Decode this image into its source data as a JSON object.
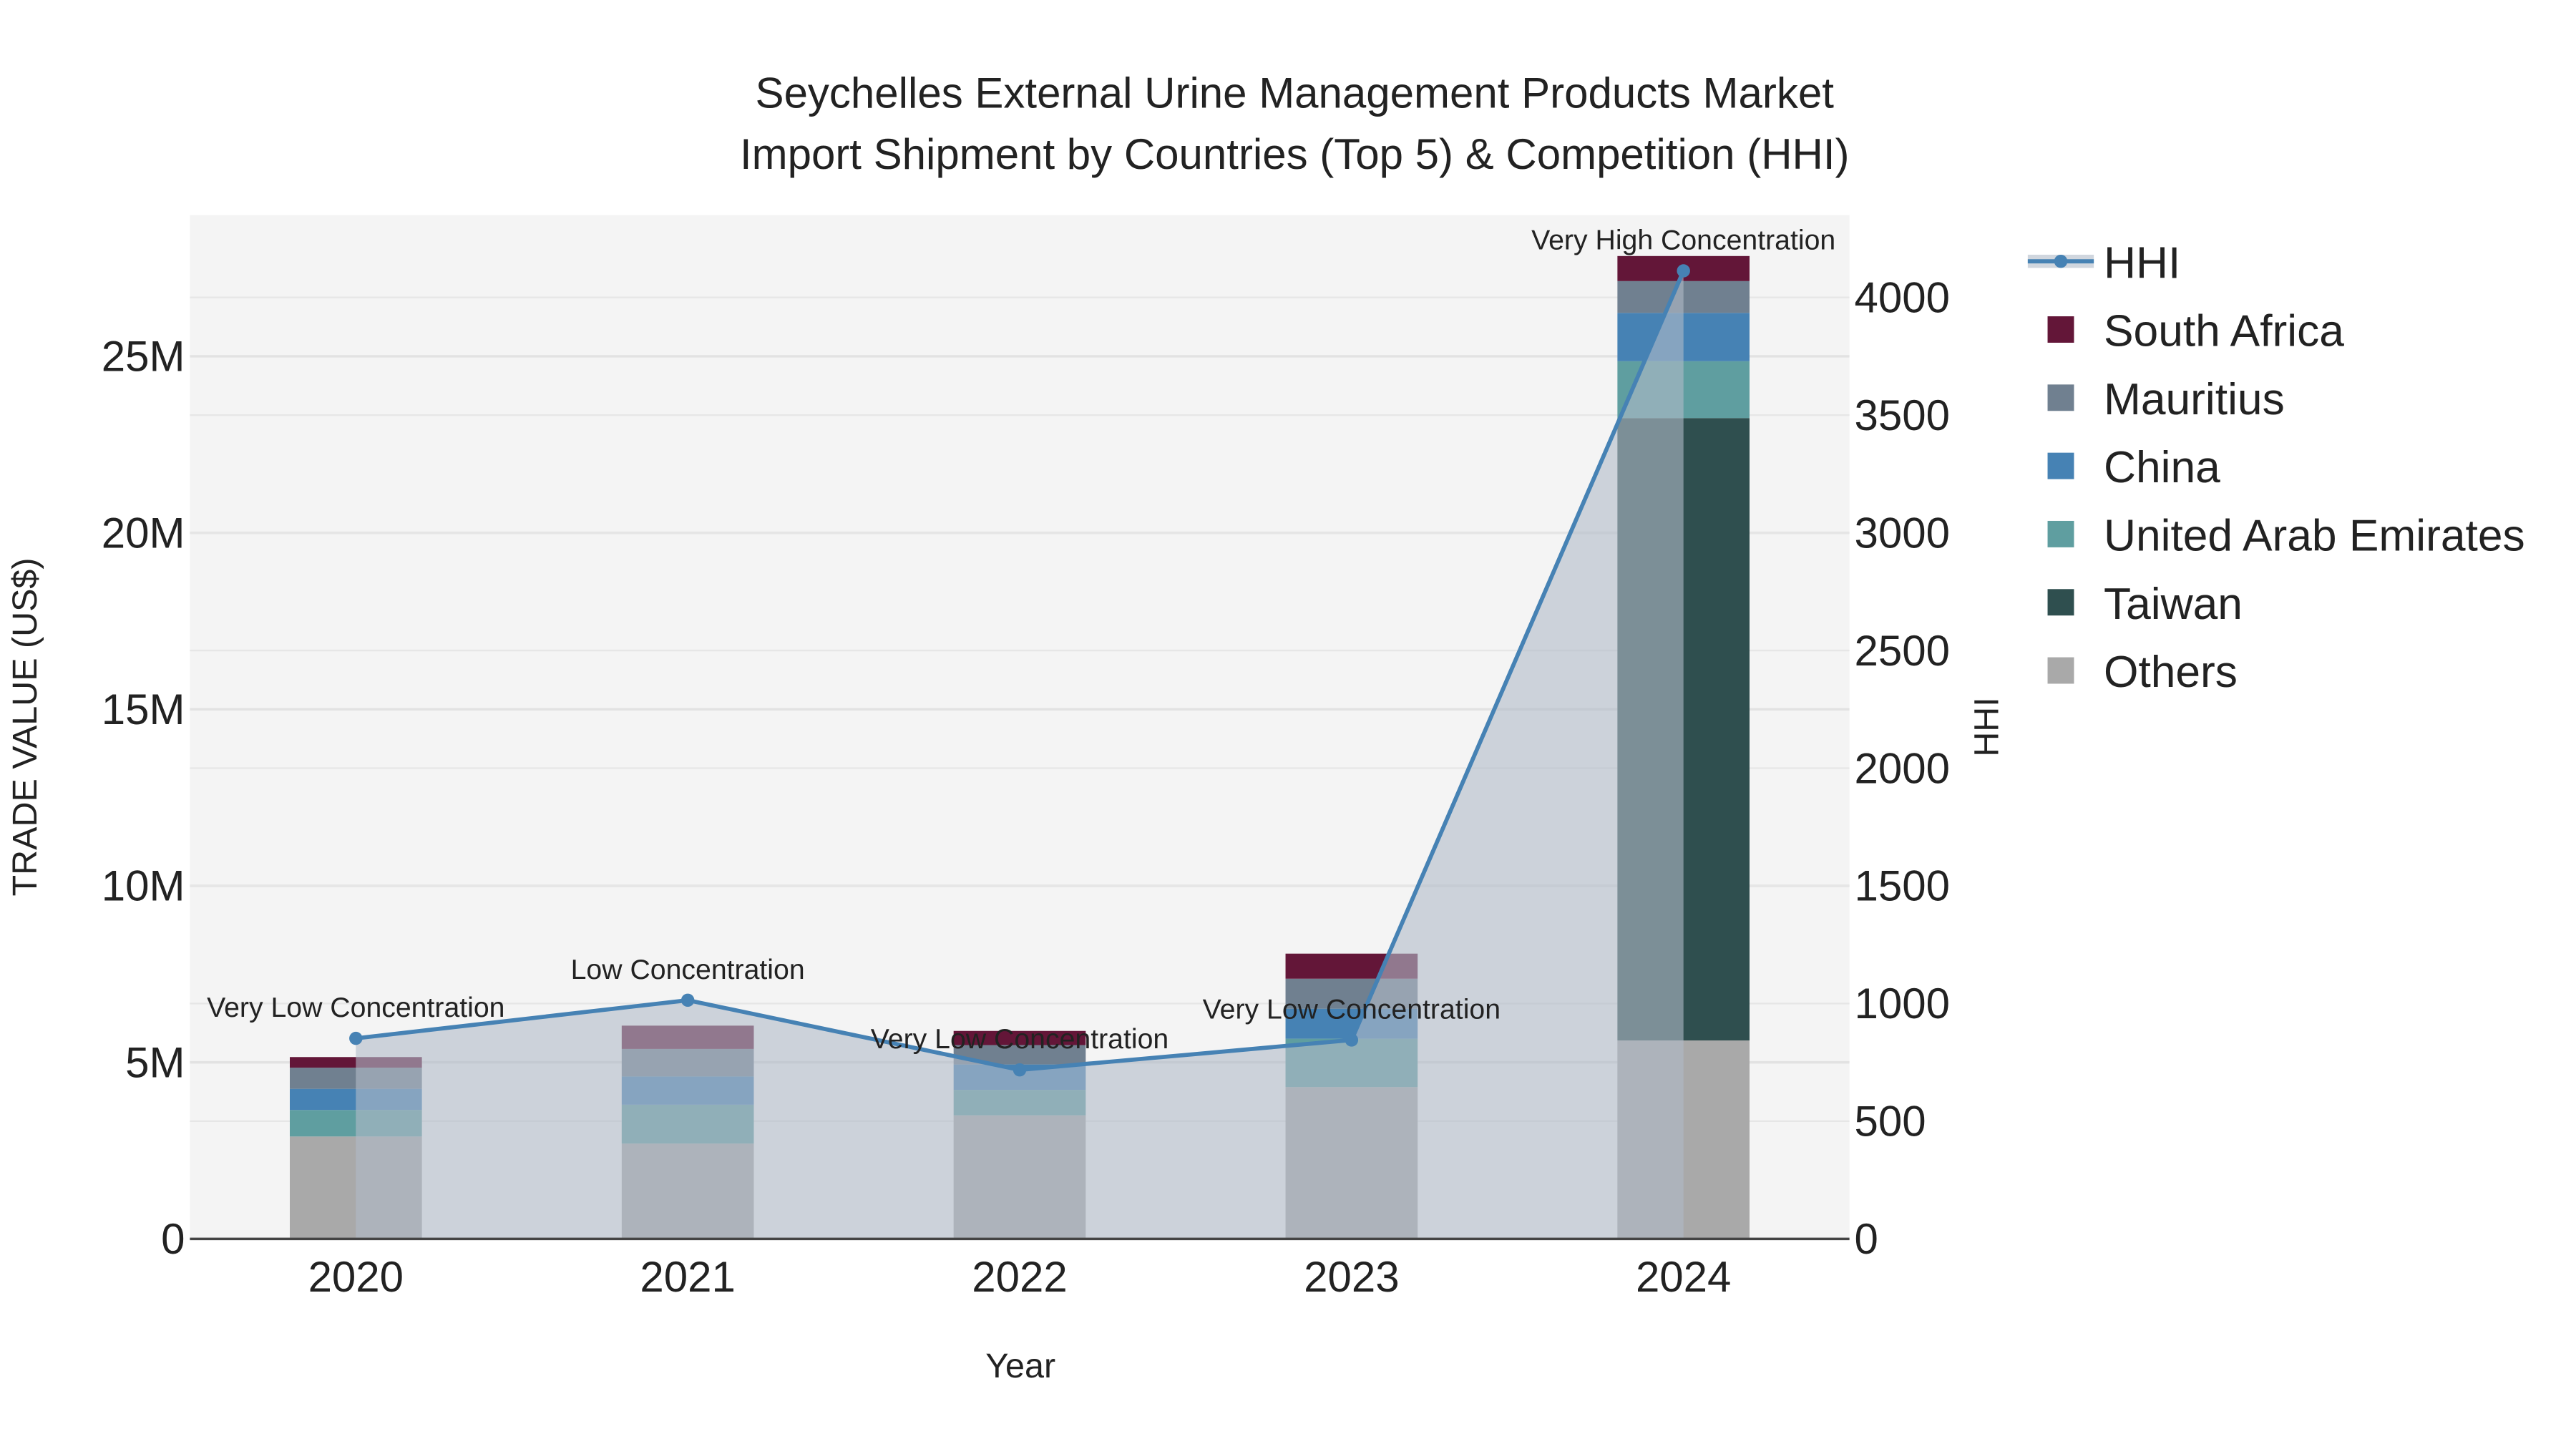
{
  "chart_data": {
    "type": "bar",
    "title_line1": "Seychelles External Urine Management Products Market",
    "title_line2": "Import Shipment by Countries (Top 5) & Competition (HHI)",
    "xlabel": "Year",
    "ylabel": "TRADE VALUE (US$)",
    "y2label": "HHI",
    "categories": [
      "2020",
      "2021",
      "2022",
      "2023",
      "2024"
    ],
    "ylim": [
      0,
      29000000
    ],
    "y2lim": [
      0,
      4350
    ],
    "yticks": [
      0,
      5000000,
      10000000,
      15000000,
      20000000,
      25000000
    ],
    "ytick_labels": [
      "0",
      "5M",
      "10M",
      "15M",
      "20M",
      "25M"
    ],
    "y2ticks": [
      0,
      500,
      1000,
      1500,
      2000,
      2500,
      3000,
      3500,
      4000
    ],
    "y2tick_labels": [
      "0",
      "500",
      "1000",
      "1500",
      "2000",
      "2500",
      "3000",
      "3500",
      "4000"
    ],
    "series": [
      {
        "name": "Others",
        "color": "#a9a9a9",
        "values": [
          2900000,
          2700000,
          3500000,
          4300000,
          5620000
        ]
      },
      {
        "name": "Taiwan",
        "color": "#2f4f4f",
        "values": [
          0,
          0,
          0,
          0,
          17630000
        ]
      },
      {
        "name": "United Arab Emirates",
        "color": "#5f9ea0",
        "values": [
          750000,
          1100000,
          720000,
          1370000,
          1610000
        ]
      },
      {
        "name": "China",
        "color": "#4682b4",
        "values": [
          600000,
          800000,
          720000,
          850000,
          1370000
        ]
      },
      {
        "name": "Mauritius",
        "color": "#708090",
        "values": [
          600000,
          780000,
          550000,
          850000,
          900000
        ]
      },
      {
        "name": "South Africa",
        "color": "#631638",
        "values": [
          300000,
          660000,
          400000,
          710000,
          710000
        ]
      }
    ],
    "hhi": {
      "name": "HHI",
      "color": "#4682b4",
      "values": [
        852,
        1014,
        718,
        845,
        4113
      ],
      "annotations": [
        "Very Low Concentration",
        "Low Concentration",
        "Very Low Concentration",
        "Very Low Concentration",
        "Very High Concentration"
      ]
    },
    "legend_order": [
      "HHI",
      "South Africa",
      "Mauritius",
      "China",
      "United Arab Emirates",
      "Taiwan",
      "Others"
    ],
    "legend_position": "right",
    "grid": true
  }
}
